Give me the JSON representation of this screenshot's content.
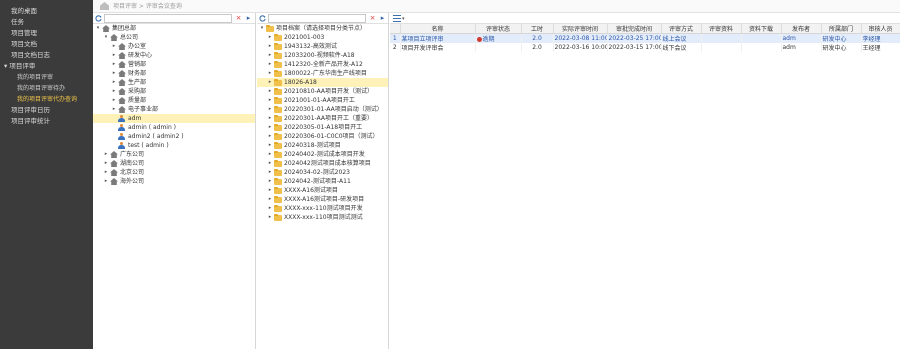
{
  "nav": {
    "items": [
      {
        "label": "我的桌面",
        "kind": "item"
      },
      {
        "label": "任务",
        "kind": "item"
      },
      {
        "label": "项目管理",
        "kind": "item"
      },
      {
        "label": "项目文档",
        "kind": "item"
      },
      {
        "label": "项目文档日志",
        "kind": "item"
      },
      {
        "label": "▾ 项目评审",
        "kind": "group"
      },
      {
        "label": "我的项目评审",
        "kind": "sub"
      },
      {
        "label": "我的项目评审待办",
        "kind": "sub"
      },
      {
        "label": "我的项目评审代办查询",
        "kind": "sub",
        "active": true
      },
      {
        "label": "项目评审日历",
        "kind": "item"
      },
      {
        "label": "项目评审统计",
        "kind": "item"
      }
    ]
  },
  "breadcrumb": {
    "text": "项目评审 > 评审会议查询"
  },
  "org_tree": {
    "search_placeholder": "",
    "nodes": [
      {
        "label": "集团总部",
        "level": 0,
        "toggle": "▾",
        "icon": "house"
      },
      {
        "label": "总公司",
        "level": 1,
        "toggle": "▾",
        "icon": "house"
      },
      {
        "label": "办公室",
        "level": 2,
        "toggle": "▸",
        "icon": "house"
      },
      {
        "label": "研发中心",
        "level": 2,
        "toggle": "▸",
        "icon": "house"
      },
      {
        "label": "营销部",
        "level": 2,
        "toggle": "▸",
        "icon": "house"
      },
      {
        "label": "财务部",
        "level": 2,
        "toggle": "▸",
        "icon": "house"
      },
      {
        "label": "生产部",
        "level": 2,
        "toggle": "▸",
        "icon": "house"
      },
      {
        "label": "采购部",
        "level": 2,
        "toggle": "▸",
        "icon": "house"
      },
      {
        "label": "质量部",
        "level": 2,
        "toggle": "▸",
        "icon": "house"
      },
      {
        "label": "电子事业部",
        "level": 2,
        "toggle": "▸",
        "icon": "house"
      },
      {
        "label": "adm",
        "level": 2,
        "toggle": "",
        "icon": "person",
        "selected": true
      },
      {
        "label": "admin ( admin )",
        "level": 2,
        "toggle": "",
        "icon": "person"
      },
      {
        "label": "admin2 ( admin2 )",
        "level": 2,
        "toggle": "",
        "icon": "person"
      },
      {
        "label": "test ( admin )",
        "level": 2,
        "toggle": "",
        "icon": "person"
      },
      {
        "label": "广东公司",
        "level": 1,
        "toggle": "▸",
        "icon": "house"
      },
      {
        "label": "湖南公司",
        "level": 1,
        "toggle": "▸",
        "icon": "house"
      },
      {
        "label": "北京公司",
        "level": 1,
        "toggle": "▸",
        "icon": "house"
      },
      {
        "label": "海外公司",
        "level": 1,
        "toggle": "▸",
        "icon": "house"
      }
    ]
  },
  "project_tree": {
    "search_placeholder": "",
    "nodes": [
      {
        "label": "项目档案（请选择项目分类节点）",
        "level": 0,
        "toggle": "▾"
      },
      {
        "label": "2021001-003",
        "level": 1,
        "toggle": "▸"
      },
      {
        "label": "1943132-高效测试",
        "level": 1,
        "toggle": "▸"
      },
      {
        "label": "12033200-视频软件-A18",
        "level": 1,
        "toggle": "▸"
      },
      {
        "label": "1412320-全新产品开发-A12",
        "level": 1,
        "toggle": "▸"
      },
      {
        "label": "1800022-广东华南生产线项目",
        "level": 1,
        "toggle": "▸"
      },
      {
        "label": "18026-A18",
        "level": 1,
        "toggle": "▸",
        "selected": true
      },
      {
        "label": "20210810-AA项目开发（测试）",
        "level": 1,
        "toggle": "▸"
      },
      {
        "label": "2021001-01-AA项目开工",
        "level": 1,
        "toggle": "▸"
      },
      {
        "label": "20220301-01-AA项目启动（测试）",
        "level": 1,
        "toggle": "▸"
      },
      {
        "label": "20220301-AA项目开工（重要）",
        "level": 1,
        "toggle": "▸"
      },
      {
        "label": "20220305-01-A18项目开工",
        "level": 1,
        "toggle": "▸"
      },
      {
        "label": "20220306-01-C0C0项目（测试）",
        "level": 1,
        "toggle": "▸"
      },
      {
        "label": "20240318-测试项目",
        "level": 1,
        "toggle": "▸"
      },
      {
        "label": "20240402-测试成本项目开发",
        "level": 1,
        "toggle": "▸"
      },
      {
        "label": "2024042测试项目成本核算项目",
        "level": 1,
        "toggle": "▸"
      },
      {
        "label": "2024034-02-测试2023",
        "level": 1,
        "toggle": "▸"
      },
      {
        "label": "2024042-测试项目-A11",
        "level": 1,
        "toggle": "▸"
      },
      {
        "label": "XXXX-A16测试项目",
        "level": 1,
        "toggle": "▸"
      },
      {
        "label": "XXXX-A16测试项目-研发项目",
        "level": 1,
        "toggle": "▸"
      },
      {
        "label": "XXXX-xxx-110测试项目开发",
        "level": 1,
        "toggle": "▸"
      },
      {
        "label": "XXXX-xxx-110项目测试测试",
        "level": 1,
        "toggle": "▸"
      }
    ]
  },
  "grid": {
    "columns": [
      "",
      "名称",
      "评审状态",
      "工时",
      "实际评审时间",
      "审批完成时间",
      "评审方式",
      "评审资料",
      "资料下载",
      "发布者",
      "所属部门",
      "审核人员"
    ],
    "rows": [
      {
        "num": "1",
        "name": "某项目立项评审",
        "status": "逾期",
        "hours": "2.0",
        "review_time": "2022-03-08 11:00",
        "approve_time": "2022-03-25 17:00",
        "method": "线上会议",
        "materials": "",
        "download": "",
        "publisher": "adm",
        "dept": "研发中心",
        "auditor": "李经理",
        "selected": true
      },
      {
        "num": "2",
        "name": "项目开发评审会",
        "status": "",
        "hours": "2.0",
        "review_time": "2022-03-16 10:00",
        "approve_time": "2022-03-15 17:00",
        "method": "线下会议",
        "materials": "",
        "download": "",
        "publisher": "adm",
        "dept": "研发中心",
        "auditor": "王经理",
        "selected": false
      }
    ]
  }
}
